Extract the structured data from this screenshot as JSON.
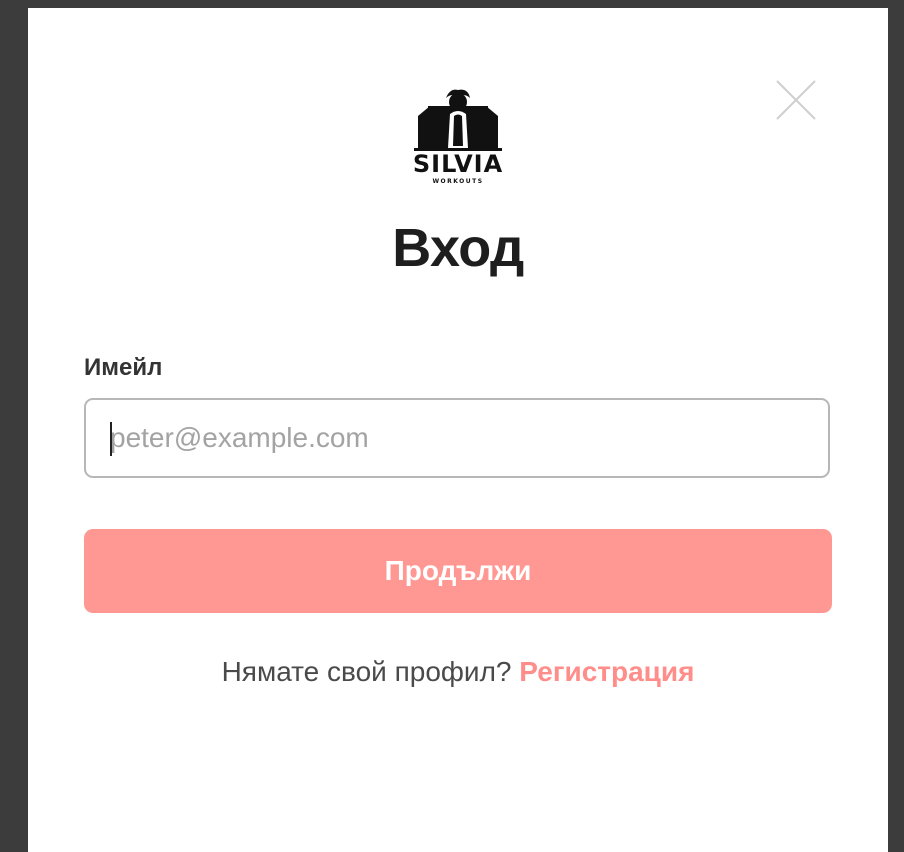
{
  "modal": {
    "logo": {
      "brand": "SILVIA",
      "tagline": "WORKOUTS",
      "icon": "silvia-workouts-logo-icon"
    },
    "close_icon": "close-icon",
    "title": "Вход",
    "email": {
      "label": "Имейл",
      "value": "",
      "placeholder": "peter@example.com"
    },
    "continue_label": "Продължи",
    "signup": {
      "prompt": "Нямате свой профил?",
      "link_label": "Регистрация"
    }
  },
  "colors": {
    "accent": "#ff9893",
    "link": "#ff8e8a",
    "backdrop": "#3c3c3c",
    "text": "#1e1e1e"
  }
}
